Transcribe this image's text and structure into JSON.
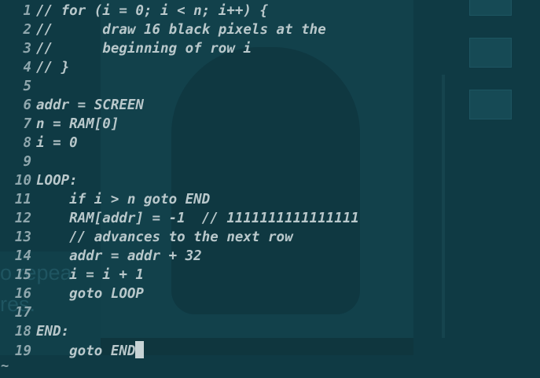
{
  "colors": {
    "background": "#0f3a44",
    "text": "#b9c8cb",
    "line_number": "#8fa7ad",
    "cursor": "#c7d3d5"
  },
  "editor": {
    "lines": [
      {
        "n": "1",
        "text": "// for (i = 0; i < n; i++) {"
      },
      {
        "n": "2",
        "text": "//      draw 16 black pixels at the"
      },
      {
        "n": "3",
        "text": "//      beginning of row i"
      },
      {
        "n": "4",
        "text": "// }"
      },
      {
        "n": "5",
        "text": ""
      },
      {
        "n": "6",
        "text": "addr = SCREEN"
      },
      {
        "n": "7",
        "text": "n = RAM[0]"
      },
      {
        "n": "8",
        "text": "i = 0"
      },
      {
        "n": "9",
        "text": ""
      },
      {
        "n": "10",
        "text": "LOOP:"
      },
      {
        "n": "11",
        "text": "    if i > n goto END"
      },
      {
        "n": "12",
        "text": "    RAM[addr] = -1  // 1111111111111111"
      },
      {
        "n": "13",
        "text": "    // advances to the next row"
      },
      {
        "n": "14",
        "text": "    addr = addr + 32"
      },
      {
        "n": "15",
        "text": "    i = i + 1"
      },
      {
        "n": "16",
        "text": "    goto LOOP"
      },
      {
        "n": "17",
        "text": ""
      },
      {
        "n": "18",
        "text": "END:"
      },
      {
        "n": "19",
        "text": "    goto END"
      }
    ],
    "empty_line_marker": "~"
  },
  "background": {
    "ghost_text_1": "o repea",
    "ghost_text_2": "res."
  }
}
